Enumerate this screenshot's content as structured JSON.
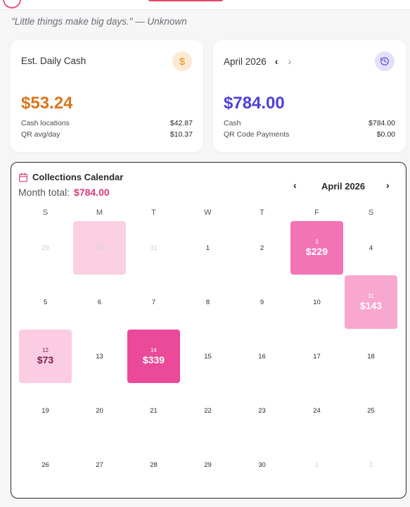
{
  "quote": "\"Little things make big days.\" — Unknown",
  "daily_card": {
    "title": "Est. Daily Cash",
    "icon": "dollar-icon",
    "icon_glyph": "$",
    "amount": "$53.24",
    "rows": [
      {
        "label": "Cash locations",
        "value": "$42.87"
      },
      {
        "label": "QR avg/day",
        "value": "$10.37"
      }
    ]
  },
  "month_card": {
    "title": "April 2026",
    "prev": "‹",
    "next": "›",
    "icon": "history-icon",
    "amount": "$784.00",
    "rows": [
      {
        "label": "Cash",
        "value": "$784.00"
      },
      {
        "label": "QR Code Payments",
        "value": "$0.00"
      }
    ]
  },
  "calendar": {
    "title": "Collections Calendar",
    "month_total_label": "Month total:",
    "month_total": "$784.00",
    "month_label": "April 2026",
    "prev": "‹",
    "next": "›",
    "weekdays": [
      "S",
      "M",
      "T",
      "W",
      "T",
      "F",
      "S"
    ],
    "weeks": [
      [
        {
          "d": "29",
          "muted": true
        },
        {
          "d": "30",
          "muted": true,
          "shade": "faded"
        },
        {
          "d": "31",
          "muted": true
        },
        {
          "d": "1"
        },
        {
          "d": "2"
        },
        {
          "d": "3",
          "amt": "$229",
          "shade": "strong"
        },
        {
          "d": "4"
        }
      ],
      [
        {
          "d": "5"
        },
        {
          "d": "6"
        },
        {
          "d": "7"
        },
        {
          "d": "8"
        },
        {
          "d": "9"
        },
        {
          "d": "10"
        },
        {
          "d": "11",
          "amt": "$143",
          "shade": "mid"
        }
      ],
      [
        {
          "d": "12",
          "amt": "$73",
          "shade": "pale"
        },
        {
          "d": "13"
        },
        {
          "d": "14",
          "amt": "$339",
          "shade": "deep"
        },
        {
          "d": "15"
        },
        {
          "d": "16"
        },
        {
          "d": "17"
        },
        {
          "d": "18"
        }
      ],
      [
        {
          "d": "19"
        },
        {
          "d": "20"
        },
        {
          "d": "21"
        },
        {
          "d": "22"
        },
        {
          "d": "23"
        },
        {
          "d": "24"
        },
        {
          "d": "25"
        }
      ],
      [
        {
          "d": "26"
        },
        {
          "d": "27"
        },
        {
          "d": "28"
        },
        {
          "d": "29"
        },
        {
          "d": "30"
        },
        {
          "d": "1",
          "muted": true
        },
        {
          "d": "2",
          "muted": true
        }
      ]
    ]
  },
  "colors": {
    "accent_pink": "#d63a7a",
    "orange": "#d9761c",
    "purple": "#5040d8"
  }
}
